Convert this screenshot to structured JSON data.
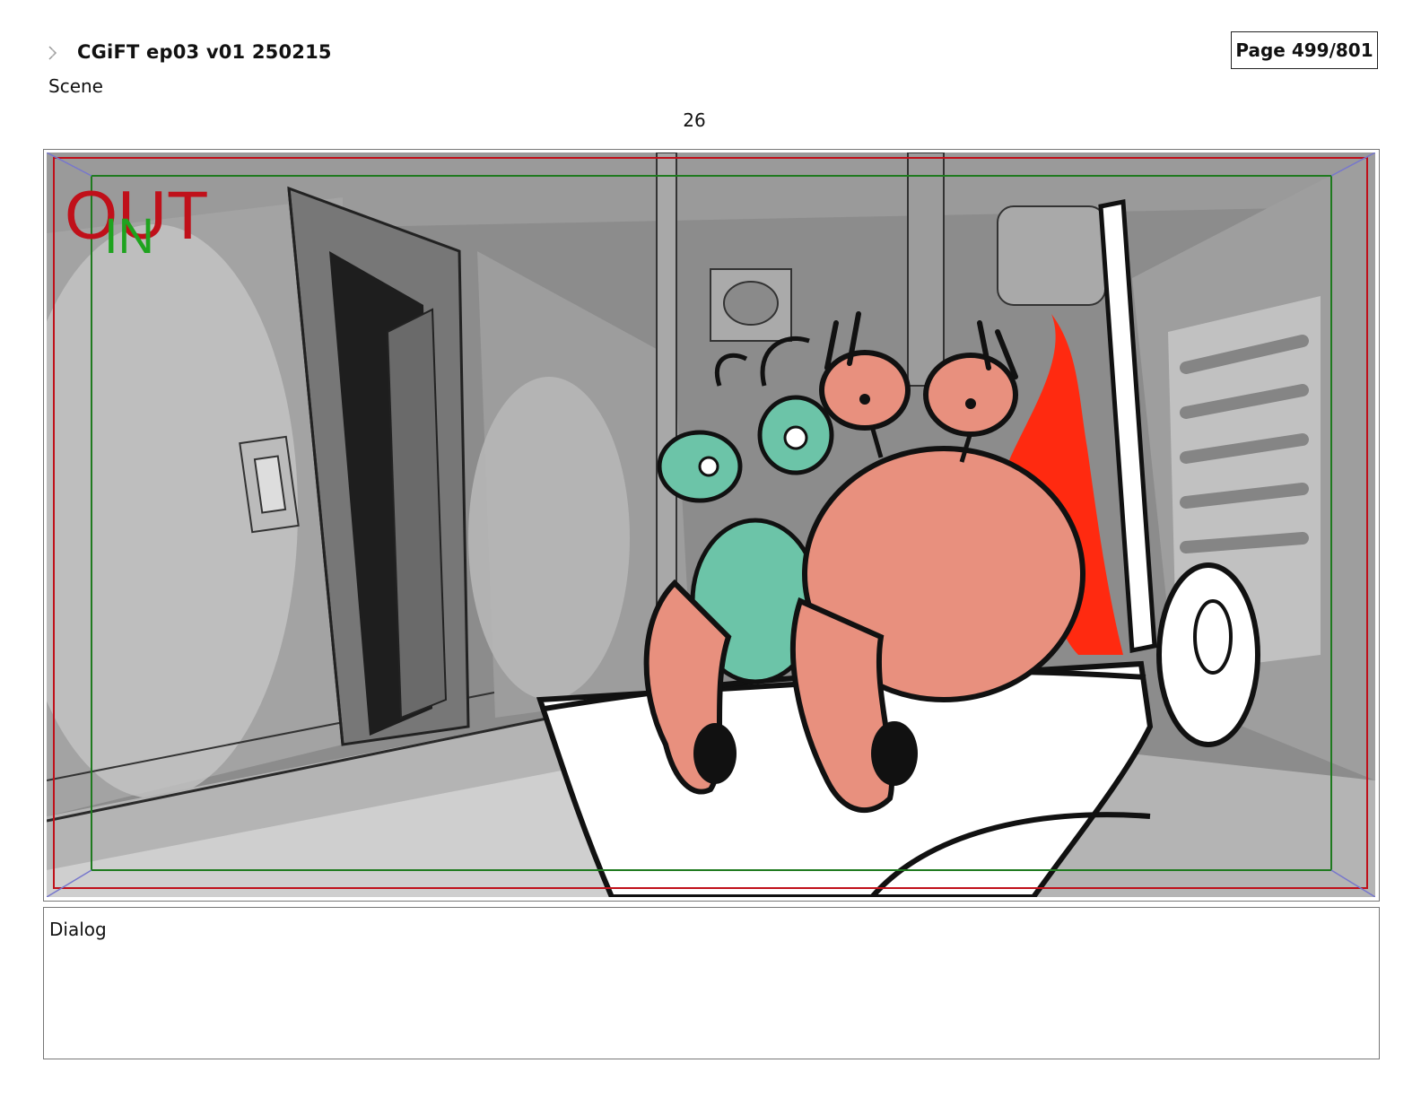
{
  "header": {
    "app_icon": "storyboard-app-icon",
    "title": "CGiFT ep03 v01 250215",
    "page": "Page 499/801"
  },
  "scene": {
    "label": "Scene",
    "number": "26"
  },
  "panel": {
    "out_label": "OUT",
    "in_label": "IN",
    "colors": {
      "out_frame": "#c0101a",
      "in_frame": "#1f7a1f",
      "crab_body": "#e8907e",
      "alien_body": "#6cc4a8",
      "splatter": "#ff2a10",
      "background_gray": "#8a8a8a"
    }
  },
  "dialog": {
    "label": "Dialog",
    "text": ""
  }
}
